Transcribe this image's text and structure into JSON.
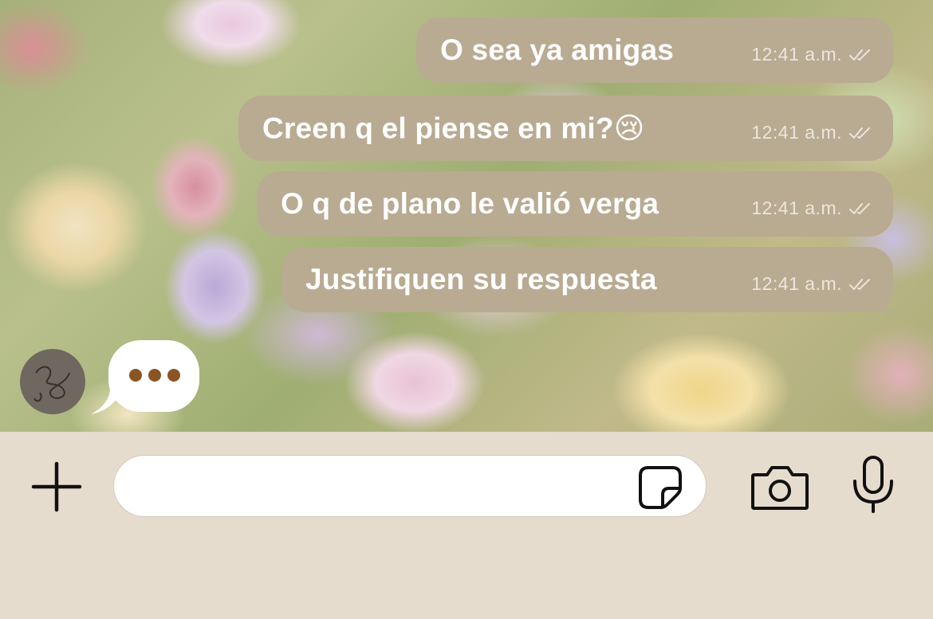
{
  "chat": {
    "messages": [
      {
        "text": "O sea ya amigas",
        "time": "12:41 a.m.",
        "status": "read-double-check"
      },
      {
        "text": "Creen q el piense en mi?😢",
        "time": "12:41 a.m.",
        "status": "read-double-check"
      },
      {
        "text": "O q de plano le valió verga",
        "time": "12:41 a.m.",
        "status": "read-double-check"
      },
      {
        "text": "Justifiquen su respuesta",
        "time": "12:41 a.m.",
        "status": "read-double-check"
      }
    ],
    "typing_indicator": {
      "avatar_icon": "contact-avatar",
      "dots": 3,
      "dot_color": "#8b5424"
    },
    "bubble_color": "#b9aa92"
  },
  "composer": {
    "input_value": "",
    "input_placeholder": "",
    "icons": [
      "plus-icon",
      "sticker-icon",
      "camera-icon",
      "microphone-icon"
    ],
    "background": "#e5dccd"
  }
}
